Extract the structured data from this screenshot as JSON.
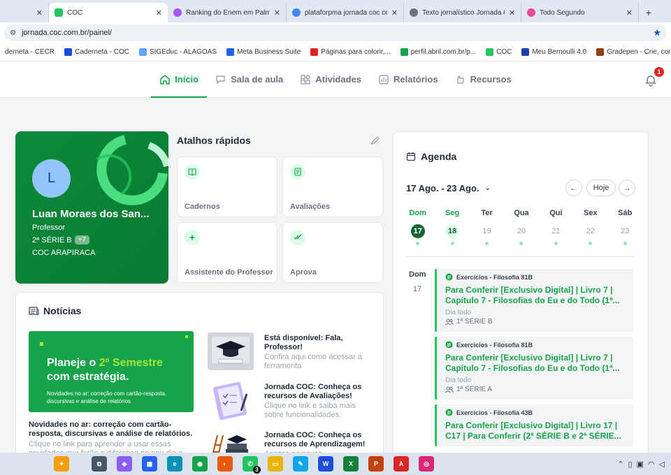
{
  "browser": {
    "tabs": [
      {
        "title": "",
        "color": "#dfe8f3"
      },
      {
        "title": "COC",
        "color": "#22c55e",
        "active": true
      },
      {
        "title": "Ranking do Enem em Palmei",
        "color": "#a855f7"
      },
      {
        "title": "plataforpma jornada coc com",
        "color": "#4285f4"
      },
      {
        "title": "Texto jornalístico Jornada CO",
        "color": "#6b7280"
      },
      {
        "title": "Todo Segundo",
        "color": "#ec4899"
      }
    ],
    "close_glyph": "✕",
    "new_tab_glyph": "+",
    "url": "jornada.coc.com.br/painel/",
    "bookmarks": [
      {
        "label": "derneta - CECR",
        "color": ""
      },
      {
        "label": "Caderneta - COC",
        "color": "#1d4ed8"
      },
      {
        "label": "SIGEduc - ALAGOAS",
        "color": "#60a5fa"
      },
      {
        "label": "Meta Business Suite",
        "color": "#2563eb"
      },
      {
        "label": "Páginas para colorir,...",
        "color": "#dc2626"
      },
      {
        "label": "perfil.abril.com.br/p...",
        "color": "#16a34a"
      },
      {
        "label": "COC",
        "color": "#22c55e"
      },
      {
        "label": "Meu Bernoulli 4.0",
        "color": "#1e40af"
      },
      {
        "label": "Gradepen - Crie, cor...",
        "color": "#92400e"
      }
    ],
    "bookmarks_more": "»"
  },
  "nav": {
    "items": [
      {
        "label": "Início",
        "icon": "home-icon",
        "active": true
      },
      {
        "label": "Sala de aula",
        "icon": "chat-icon"
      },
      {
        "label": "Atividades",
        "icon": "grid-icon"
      },
      {
        "label": "Relatórios",
        "icon": "chart-icon"
      },
      {
        "label": "Recursos",
        "icon": "hand-icon"
      }
    ],
    "notification_count": "1"
  },
  "profile": {
    "initial": "L",
    "name": "Luan Moraes dos San...",
    "role": "Professor",
    "class": "2ª SÉRIE B",
    "extra": "+7",
    "school": "COC ARAPIRACA"
  },
  "shortcuts": {
    "title": "Atalhos rápidos",
    "items": [
      {
        "label": "Cadernos",
        "icon": "book-icon"
      },
      {
        "label": "Avaliações",
        "icon": "checklist-icon"
      },
      {
        "label": "Assistente do Professor",
        "icon": "sparkle-icon"
      },
      {
        "label": "Aprova",
        "icon": "double-check-icon"
      }
    ]
  },
  "news": {
    "title": "Notícias",
    "banner": {
      "line1_a": "Planeje o ",
      "line1_b": "2º Semestre",
      "line2": "com estratégia.",
      "small": "Novidades no ar: correção com cartão-resposta, discursivas e análise de relatórios"
    },
    "main_title": "Novidades no ar: correção com cartão-resposta, discursivas e análise de relatórios.",
    "main_sub": "Clique no link para aprender a usar essas novidades que farão a diferença no seu dia a",
    "items": [
      {
        "title": "Está disponível: Fala, Professor!",
        "sub": "Confira aqui como acessar a ferramenta"
      },
      {
        "title": "Jornada COC: Conheça os recursos de Avaliações!",
        "sub": "Clique no link e saiba mais sobre funcionalidades."
      },
      {
        "title": "Jornada COC: Conheça os recursos de Aprendizagem!",
        "sub": "Acesse as novas"
      }
    ]
  },
  "agenda": {
    "title": "Agenda",
    "range": "17 Ago. - 23 Ago.",
    "today_label": "Hoje",
    "days": [
      {
        "name": "Dom",
        "num": "17",
        "state": "today"
      },
      {
        "name": "Seg",
        "num": "18",
        "state": "sel"
      },
      {
        "name": "Ter",
        "num": "19",
        "state": ""
      },
      {
        "name": "Qua",
        "num": "20",
        "state": ""
      },
      {
        "name": "Qui",
        "num": "21",
        "state": ""
      },
      {
        "name": "Sex",
        "num": "22",
        "state": ""
      },
      {
        "name": "Sáb",
        "num": "23",
        "state": ""
      }
    ],
    "list_day_name": "Dom",
    "list_day_num": "17",
    "events": [
      {
        "category": "Exercícios - Filosofia 81B",
        "title": "Para Conferir [Exclusivo Digital] | Livro 7 | Capítulo 7 - Filosofias do Eu e do Todo (1ª...",
        "when": "Dia todo",
        "class": "1ª SÉRIE B"
      },
      {
        "category": "Exercícios - Filosofia 81B",
        "title": "Para Conferir [Exclusivo Digital] | Livro 7 | Capítulo 7 - Filosofias do Eu e do Todo (1ª...",
        "when": "Dia todo",
        "class": "1ª SÉRIE A"
      },
      {
        "category": "Exercícios - Filosofia 43B",
        "title": "Para Conferir [Exclusivo Digital] | Livro 17 | C17 | Para Conferir (2ª SÉRIE B e 2ª SÉRIE...",
        "when": "",
        "class": ""
      }
    ]
  },
  "taskbar": {
    "apps": [
      {
        "name": "copilot-icon",
        "color": "#f59e0b",
        "label": "✦"
      },
      {
        "name": "taskview-icon",
        "color": "#475569",
        "label": "⧉"
      },
      {
        "name": "copilot-app-icon",
        "color": "#8b5cf6",
        "label": "◆"
      },
      {
        "name": "store-icon",
        "color": "#2563eb",
        "label": "▦"
      },
      {
        "name": "edge-icon",
        "color": "#0891b2",
        "label": "e"
      },
      {
        "name": "chrome-icon",
        "color": "#16a34a",
        "label": "◉"
      },
      {
        "name": "firefox-icon",
        "color": "#ea580c",
        "label": "◐"
      },
      {
        "name": "whatsapp-icon",
        "color": "#22c55e",
        "label": "✆"
      },
      {
        "name": "explorer-icon",
        "color": "#eab308",
        "label": "▭"
      },
      {
        "name": "notes-icon",
        "color": "#0ea5e9",
        "label": "✎"
      },
      {
        "name": "word-icon",
        "color": "#1d4ed8",
        "label": "W"
      },
      {
        "name": "excel-icon",
        "color": "#15803d",
        "label": "X"
      },
      {
        "name": "powerpoint-icon",
        "color": "#c2410c",
        "label": "P"
      },
      {
        "name": "acrobat-icon",
        "color": "#dc2626",
        "label": "A"
      },
      {
        "name": "instagram-icon",
        "color": "#db2777",
        "label": "◎"
      }
    ],
    "whatsapp_badge": "3"
  }
}
